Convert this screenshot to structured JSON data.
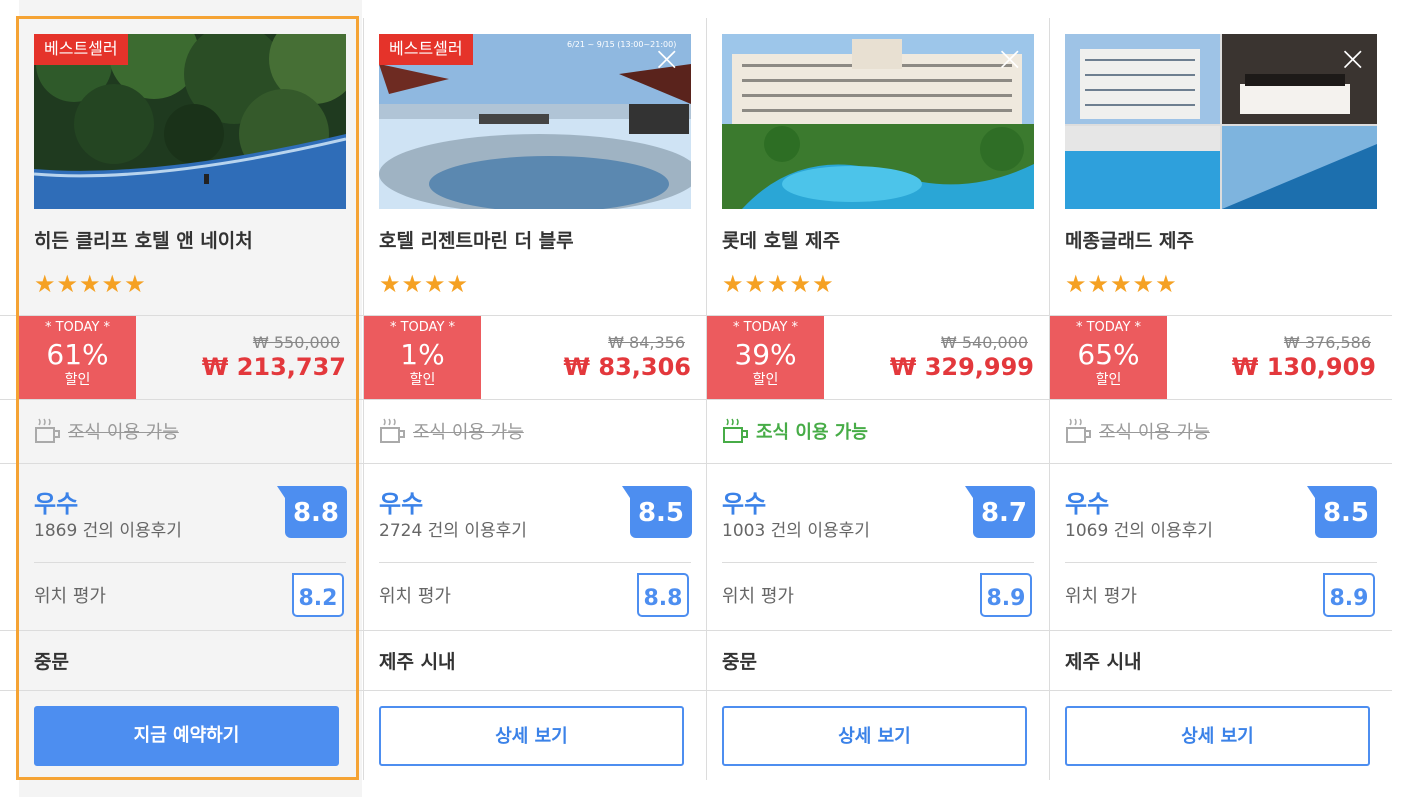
{
  "hotels": [
    {
      "badge": "베스트셀러",
      "name": "히든 클리프 호텔 앤 네이처",
      "stars": "★★★★★",
      "today_label": "* TODAY *",
      "discount": "61%",
      "discount_unit": "할인",
      "original_price": "₩ 550,000",
      "price": "₩ 213,737",
      "breakfast": "조식 이용 가능",
      "breakfast_available": false,
      "grade": "우수",
      "reviews": "1869 건의 이용후기",
      "score": "8.8",
      "location_label": "위치 평가",
      "location_score": "8.2",
      "area": "중문",
      "button": "지금 예약하기",
      "image": "infinity-pool-forest"
    },
    {
      "badge": "베스트셀러",
      "name": "호텔 리젠트마린 더 블루",
      "stars": "★★★★",
      "today_label": "* TODAY *",
      "discount": "1%",
      "discount_unit": "할인",
      "original_price": "₩ 84,356",
      "price": "₩ 83,306",
      "breakfast": "조식 이용 가능",
      "breakfast_available": false,
      "grade": "우수",
      "reviews": "2724 건의 이용후기",
      "score": "8.5",
      "location_label": "위치 평가",
      "location_score": "8.8",
      "area": "제주 시내",
      "button": "상세 보기",
      "image_caption": "6/21 ~ 9/15 (13:00~21:00)",
      "image": "rooftop-pool"
    },
    {
      "badge": "",
      "name": "롯데 호텔 제주",
      "stars": "★★★★★",
      "today_label": "* TODAY *",
      "discount": "39%",
      "discount_unit": "할인",
      "original_price": "₩ 540,000",
      "price": "₩ 329,999",
      "breakfast": "조식 이용 가능",
      "breakfast_available": true,
      "grade": "우수",
      "reviews": "1003 건의 이용후기",
      "score": "8.7",
      "location_label": "위치 평가",
      "location_score": "8.9",
      "area": "중문",
      "button": "상세 보기",
      "image": "resort-pool"
    },
    {
      "badge": "",
      "name": "메종글래드 제주",
      "stars": "★★★★★",
      "today_label": "* TODAY *",
      "discount": "65%",
      "discount_unit": "할인",
      "original_price": "₩ 376,586",
      "price": "₩ 130,909",
      "breakfast": "조식 이용 가능",
      "breakfast_available": false,
      "grade": "우수",
      "reviews": "1069 건의 이용후기",
      "score": "8.5",
      "location_label": "위치 평가",
      "location_score": "8.9",
      "area": "제주 시내",
      "button": "상세 보기",
      "image": "hotel-collage"
    }
  ],
  "icons": {
    "close": "×",
    "cup": "coffee-cup-icon",
    "star": "star-icon"
  },
  "colors": {
    "selected_border": "#f5a334",
    "discount_bg": "#ec5b5e",
    "price": "#e3383c",
    "score_blue": "#4d8ef0",
    "breakfast_on": "#47ac47",
    "badge": "#e5332a"
  }
}
